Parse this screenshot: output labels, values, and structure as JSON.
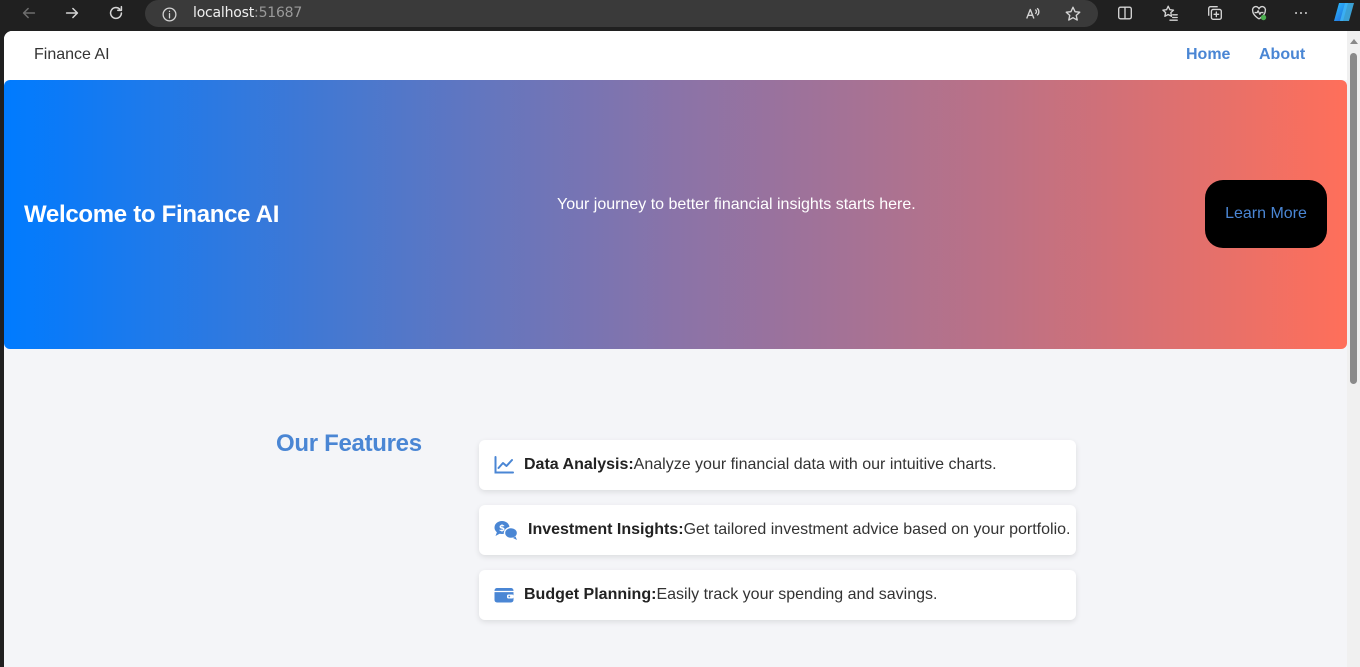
{
  "browser": {
    "url_host": "localhost",
    "url_port": ":51687"
  },
  "nav": {
    "brand": "Finance AI",
    "links": [
      "Home",
      "About"
    ]
  },
  "hero": {
    "title": "Welcome to Finance AI",
    "subtitle": "Your journey to better financial insights starts here.",
    "button": "Learn More"
  },
  "features": {
    "title": "Our Features",
    "items": [
      {
        "icon": "chart-line-icon",
        "name": "Data Analysis:",
        "desc": "Analyze your financial data with our intuitive charts."
      },
      {
        "icon": "comments-dollar-icon",
        "name": "Investment Insights:",
        "desc": "Get tailored investment advice based on your portfolio."
      },
      {
        "icon": "wallet-icon",
        "name": "Budget Planning:",
        "desc": "Easily track your spending and savings."
      }
    ]
  },
  "colors": {
    "accent": "#4a86d4",
    "gradient_start": "#007bff",
    "gradient_end": "#ff6f5a",
    "page_bg": "#f4f5f8"
  }
}
